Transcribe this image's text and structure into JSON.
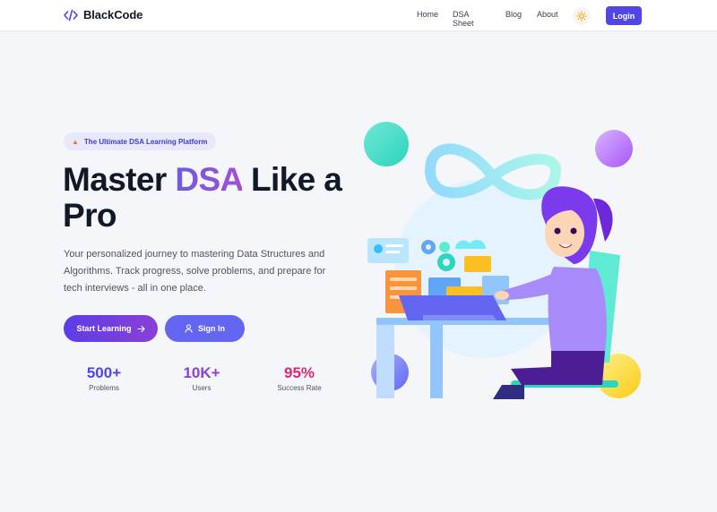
{
  "nav": {
    "brand": "BlackCode",
    "links": [
      "Home",
      "DSA Sheet",
      "Blog",
      "About"
    ],
    "theme_icon": "sun-icon",
    "login_label": "Login"
  },
  "hero": {
    "badge_icon": "flame-icon",
    "badge_text": "The Ultimate DSA Learning Platform",
    "title_pre": "Master ",
    "title_accent": "DSA",
    "title_post": " Like a Pro",
    "description": "Your personalized journey to mastering Data Structures and Algorithms. Track progress, solve problems, and prepare for tech interviews - all in one place.",
    "start_label": "Start Learning",
    "start_icon": "arrow-right-icon",
    "signin_label": "Sign In",
    "signin_icon": "user-icon"
  },
  "stats": [
    {
      "value": "500+",
      "label": "Problems"
    },
    {
      "value": "10K+",
      "label": "Users"
    },
    {
      "value": "95%",
      "label": "Success Rate"
    }
  ],
  "colors": {
    "primary": "#4f46e5",
    "accent_purple": "#8b3fd8",
    "accent_pink": "#db2777"
  }
}
